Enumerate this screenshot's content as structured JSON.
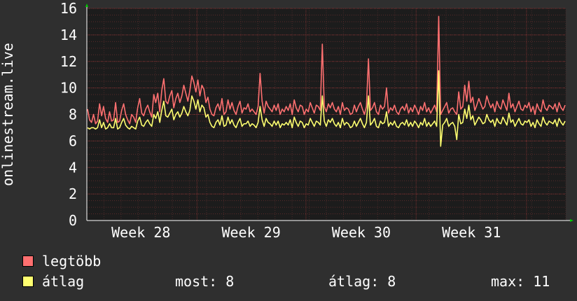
{
  "chart_data": {
    "type": "line",
    "ylabel": "onlinestream.live",
    "ylim": [
      0,
      16
    ],
    "yticks": [
      0,
      2,
      4,
      6,
      8,
      10,
      12,
      14,
      16
    ],
    "x_tick_labels": [
      "Week 28",
      "Week 29",
      "Week 30",
      "Week 31"
    ],
    "grid": true,
    "legend_position": "bottom-left",
    "background": "#1c1c1c",
    "series": [
      {
        "name": "legtöbb",
        "color": "#ff7070",
        "values": [
          8.4,
          7.6,
          7.4,
          8.0,
          7.3,
          7.5,
          8.8,
          7.9,
          8.6,
          7.7,
          7.4,
          8.2,
          7.5,
          7.6,
          8.9,
          7.4,
          7.5,
          8.3,
          8.8,
          8.0,
          7.6,
          7.3,
          8.0,
          7.8,
          7.4,
          8.5,
          9.2,
          8.1,
          7.9,
          8.4,
          8.7,
          8.2,
          7.8,
          9.5,
          8.9,
          9.6,
          8.2,
          9.8,
          10.7,
          9.0,
          8.8,
          9.4,
          9.8,
          8.5,
          9.2,
          9.6,
          8.9,
          9.4,
          10.2,
          9.6,
          9.0,
          9.8,
          10.9,
          10.4,
          9.7,
          10.6,
          9.4,
          10.2,
          9.9,
          8.9,
          9.3,
          8.4,
          8.0,
          7.9,
          8.5,
          8.8,
          8.3,
          9.2,
          8.0,
          8.2,
          9.1,
          8.4,
          8.9,
          8.3,
          8.0,
          8.6,
          9.0,
          8.1,
          8.5,
          8.4,
          8.8,
          8.2,
          8.4,
          8.2,
          8.0,
          8.6,
          11.1,
          9.0,
          8.1,
          9.0,
          8.6,
          8.4,
          8.2,
          8.7,
          8.3,
          8.8,
          8.0,
          8.4,
          8.2,
          8.6,
          8.3,
          8.8,
          8.0,
          9.1,
          8.5,
          8.2,
          8.7,
          8.6,
          8.0,
          8.4,
          8.2,
          8.9,
          8.5,
          8.1,
          8.7,
          8.6,
          8.3,
          13.3,
          8.6,
          8.2,
          8.8,
          8.5,
          8.9,
          8.4,
          8.2,
          8.6,
          8.0,
          8.9,
          8.3,
          8.5,
          8.4,
          8.0,
          8.1,
          8.7,
          8.2,
          8.6,
          8.9,
          8.4,
          8.0,
          8.6,
          12.2,
          8.3,
          8.5,
          8.9,
          8.2,
          8.0,
          8.7,
          8.4,
          8.6,
          10.0,
          8.1,
          8.5,
          8.3,
          8.7,
          8.2,
          8.0,
          8.4,
          8.6,
          8.3,
          8.8,
          8.1,
          8.5,
          8.2,
          8.7,
          8.4,
          8.0,
          8.6,
          8.3,
          8.9,
          8.2,
          8.5,
          8.1,
          8.4,
          8.7,
          8.2,
          15.4,
          8.0,
          8.3,
          8.6,
          8.9,
          8.1,
          8.4,
          8.5,
          8.2,
          8.0,
          9.7,
          8.4,
          8.6,
          10.2,
          9.0,
          10.5,
          8.9,
          9.3,
          8.3,
          8.7,
          9.2,
          8.8,
          8.4,
          8.6,
          9.4,
          8.9,
          8.5,
          8.8,
          8.2,
          9.0,
          8.6,
          8.4,
          9.1,
          8.7,
          8.3,
          9.6,
          8.5,
          8.8,
          8.2,
          8.6,
          9.0,
          8.4,
          8.3,
          8.7,
          8.5,
          8.9,
          8.2,
          8.6,
          8.0,
          8.8,
          8.4,
          8.2,
          9.1,
          8.5,
          8.3,
          8.7,
          8.6,
          8.4,
          8.8,
          8.2,
          8.9,
          8.5,
          8.3,
          8.7
        ]
      },
      {
        "name": "átlag",
        "color": "#ffff70",
        "values": [
          7.0,
          6.9,
          7.0,
          7.0,
          6.9,
          7.0,
          7.6,
          7.0,
          7.4,
          6.9,
          7.0,
          7.3,
          7.0,
          7.0,
          7.7,
          6.9,
          7.0,
          7.4,
          7.7,
          7.2,
          7.0,
          6.9,
          7.1,
          7.0,
          6.9,
          7.5,
          7.8,
          7.2,
          7.1,
          7.4,
          7.6,
          7.3,
          7.1,
          8.0,
          7.7,
          8.2,
          7.4,
          8.3,
          9.0,
          7.9,
          7.8,
          8.1,
          8.4,
          7.6,
          8.0,
          8.2,
          7.8,
          8.1,
          8.6,
          8.2,
          7.9,
          8.3,
          9.4,
          9.0,
          8.4,
          9.1,
          8.2,
          8.7,
          8.5,
          7.8,
          8.0,
          7.4,
          7.1,
          7.0,
          7.4,
          7.6,
          7.2,
          7.9,
          7.1,
          7.2,
          7.8,
          7.3,
          7.6,
          7.2,
          7.0,
          7.4,
          7.7,
          7.1,
          7.3,
          7.3,
          7.5,
          7.1,
          7.3,
          7.2,
          7.0,
          7.4,
          8.6,
          7.6,
          7.1,
          7.7,
          7.4,
          7.3,
          7.1,
          7.5,
          7.2,
          7.5,
          7.0,
          7.3,
          7.2,
          7.4,
          7.2,
          7.6,
          7.0,
          7.8,
          7.4,
          7.1,
          7.5,
          7.4,
          7.0,
          7.3,
          7.2,
          7.7,
          7.4,
          7.1,
          7.5,
          7.4,
          7.2,
          9.4,
          7.5,
          7.1,
          7.6,
          7.4,
          7.7,
          7.3,
          7.1,
          7.4,
          7.0,
          7.7,
          7.2,
          7.4,
          7.3,
          7.0,
          7.1,
          7.5,
          7.1,
          7.4,
          7.7,
          7.3,
          7.0,
          7.4,
          9.4,
          7.2,
          7.4,
          7.7,
          7.1,
          7.0,
          7.5,
          7.3,
          7.4,
          8.2,
          7.1,
          7.4,
          7.2,
          7.5,
          7.1,
          7.0,
          7.3,
          7.4,
          7.2,
          7.6,
          7.1,
          7.4,
          7.1,
          7.5,
          7.3,
          7.0,
          7.4,
          7.2,
          7.7,
          7.1,
          7.4,
          7.1,
          7.3,
          7.5,
          7.1,
          11.3,
          5.6,
          7.2,
          7.4,
          7.7,
          7.1,
          7.3,
          7.4,
          7.1,
          6.1,
          8.0,
          7.3,
          7.4,
          8.4,
          7.7,
          8.7,
          7.6,
          7.9,
          7.2,
          7.5,
          7.8,
          7.6,
          7.3,
          7.4,
          8.0,
          7.6,
          7.4,
          7.6,
          7.1,
          7.7,
          7.4,
          7.3,
          7.8,
          7.5,
          7.2,
          8.1,
          7.4,
          7.6,
          7.1,
          7.4,
          7.7,
          7.3,
          7.2,
          7.5,
          7.4,
          7.6,
          7.1,
          7.4,
          7.0,
          7.6,
          7.3,
          7.1,
          7.8,
          7.4,
          7.2,
          7.5,
          7.4,
          7.3,
          7.6,
          7.1,
          7.7,
          7.4,
          7.2,
          7.5
        ]
      }
    ]
  },
  "legend": {
    "items": [
      {
        "label": "legtöbb",
        "color": "#ff7070"
      },
      {
        "label": "átlag",
        "color": "#ffff70"
      }
    ],
    "stats": {
      "now_label": "most:",
      "now_value": "8",
      "avg_label": "átlag:",
      "avg_value": "8",
      "max_label": "max:",
      "max_value": "11"
    }
  }
}
